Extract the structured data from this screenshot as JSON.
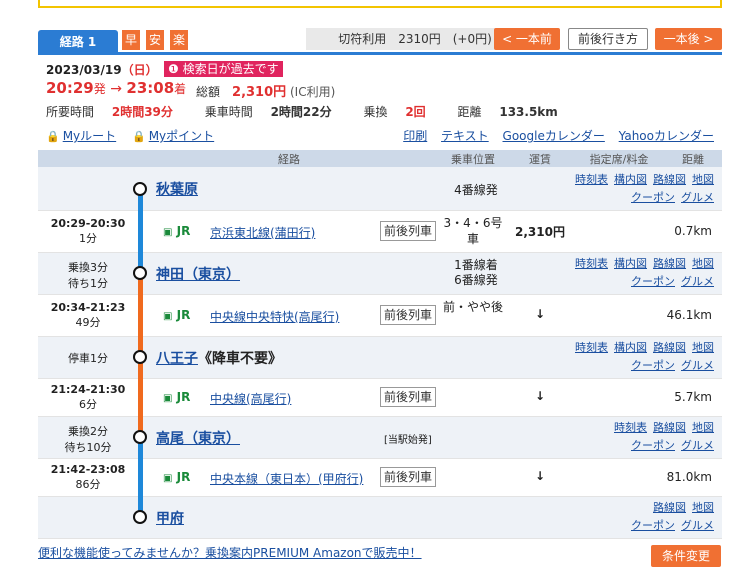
{
  "tabs": {
    "route_label": "経路 1",
    "badges": [
      "早",
      "安",
      "楽"
    ],
    "fare_use": "切符利用　2310円　(+0円)",
    "prev_btn": "< 一本前",
    "around_btn": "前後行き方",
    "next_btn": "一本後 >"
  },
  "summary": {
    "date": "2023/03/19",
    "day": "（日）",
    "warning": "検索日が過去です",
    "dep_time": "20:29",
    "dep_suffix": "発",
    "arrow": "→",
    "arr_time": "23:08",
    "arr_suffix": "着",
    "total_label": "総額",
    "total_amount": "2,310円",
    "total_note": "(IC利用)",
    "duration_label": "所要時間",
    "duration": "2時間39分",
    "ride_label": "乗車時間",
    "ride": "2時間22分",
    "transfer_label": "乗換",
    "transfer": "2回",
    "distance_label": "距離",
    "distance": "133.5km",
    "my_route": "Myルート",
    "my_point": "Myポイント",
    "links": [
      "印刷",
      "テキスト",
      "Googleカレンダー",
      "Yahooカレンダー"
    ]
  },
  "table_header": {
    "route": "経路",
    "position": "乗車位置",
    "fare": "運賃",
    "seat": "指定席/料金",
    "distance": "距離"
  },
  "stations": [
    {
      "name": "秋葉原",
      "left": "",
      "note": "4番線発",
      "links1": [
        "時刻表",
        "構内図",
        "路線図",
        "地図"
      ],
      "links2": [
        "クーポン",
        "グルメ"
      ]
    },
    {
      "name": "神田（東京）",
      "left": "乗換3分\n待ち1分",
      "note": "1番線着\n6番線発",
      "links1": [
        "時刻表",
        "構内図",
        "路線図",
        "地図"
      ],
      "links2": [
        "クーポン",
        "グルメ"
      ]
    },
    {
      "name": "八王子",
      "suffix": "《降車不要》",
      "left": "停車1分",
      "note": "",
      "links1": [
        "時刻表",
        "構内図",
        "路線図",
        "地図"
      ],
      "links2": [
        "クーポン",
        "グルメ"
      ]
    },
    {
      "name": "高尾（東京）",
      "left": "乗換2分\n待ち10分",
      "note": "[当駅始発]",
      "links1": [
        "時刻表",
        "路線図",
        "地図"
      ],
      "links2": [
        "クーポン",
        "グルメ"
      ]
    },
    {
      "name": "甲府",
      "left": "",
      "note": "",
      "links1": [
        "路線図",
        "地図"
      ],
      "links2": [
        "クーポン",
        "グルメ"
      ]
    }
  ],
  "trains": [
    {
      "time": "20:29-20:30",
      "dur": "1分",
      "company": "JR",
      "line": "京浜東北線(蒲田行)",
      "zenko": "前後列車",
      "position": "3・4・6号車",
      "fare": "2,310円",
      "distance": "0.7km"
    },
    {
      "time": "20:34-21:23",
      "dur": "49分",
      "company": "JR",
      "line": "中央線中央特快(高尾行)",
      "zenko": "前後列車",
      "position": "前・やや後",
      "fare": "↓",
      "distance": "46.1km"
    },
    {
      "time": "21:24-21:30",
      "dur": "6分",
      "company": "JR",
      "line": "中央線(高尾行)",
      "zenko": "前後列車",
      "position": "",
      "fare": "↓",
      "distance": "5.7km"
    },
    {
      "time": "21:42-23:08",
      "dur": "86分",
      "company": "JR",
      "line": "中央本線（東日本）(甲府行)",
      "zenko": "前後列車",
      "position": "",
      "fare": "↓",
      "distance": "81.0km"
    }
  ],
  "line_colors": {
    "keihin": "#1e88d9",
    "chuo_rapid": "#f06a1e",
    "chuo": "#f06a1e",
    "chuo_main": "#1e88d9"
  },
  "footer": {
    "promo": "便利な機能使ってみませんか？乗換案内PREMIUM Amazonで販売中！",
    "cond_btn": "条件変更"
  }
}
